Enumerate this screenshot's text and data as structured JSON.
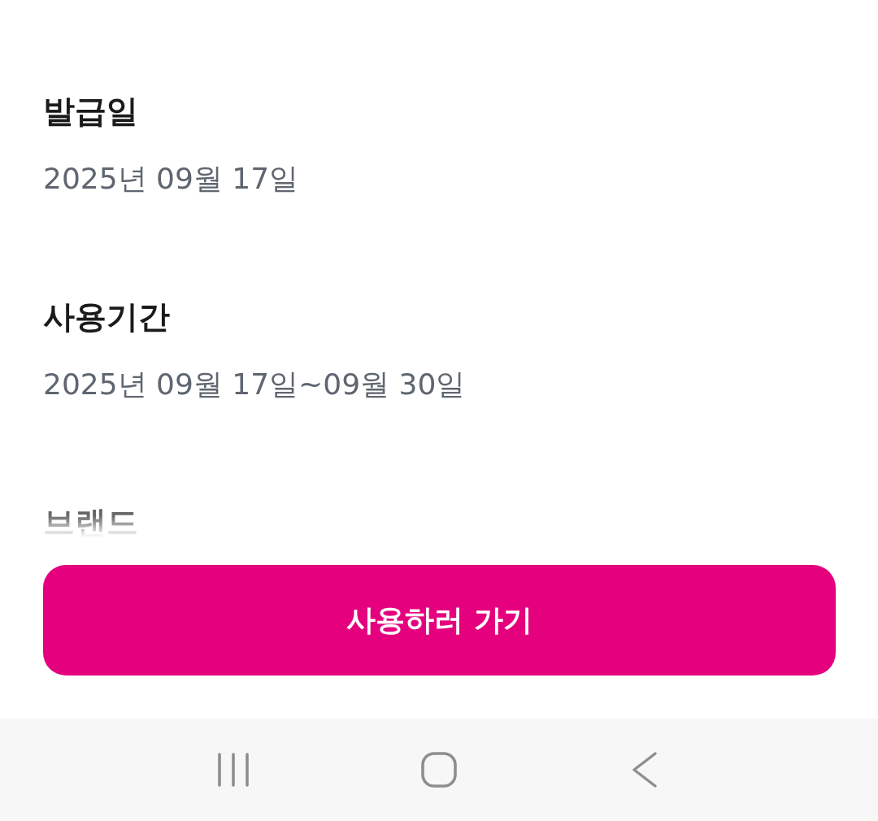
{
  "details": [
    {
      "label": "발급일",
      "value": "2025년 09월 17일",
      "faded": false
    },
    {
      "label": "사용기간",
      "value": "2025년 09월 17일~09월 30일",
      "faded": false
    },
    {
      "label": "브랜드",
      "faded": true
    }
  ],
  "button": {
    "label": "사용하러 가기"
  }
}
